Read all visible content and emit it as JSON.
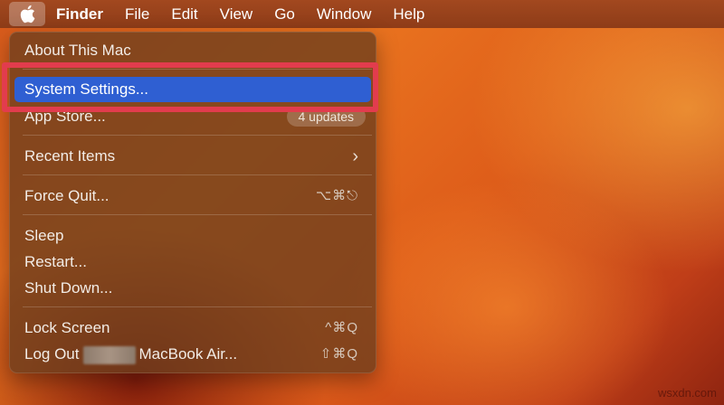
{
  "menubar": {
    "apple_icon": "apple-logo-icon",
    "app_name": "Finder",
    "items": [
      "File",
      "Edit",
      "View",
      "Go",
      "Window",
      "Help"
    ]
  },
  "apple_menu": {
    "about": "About This Mac",
    "system_settings": "System Settings...",
    "app_store": "App Store...",
    "app_store_badge": "4 updates",
    "recent_items": "Recent Items",
    "recent_items_chevron": "chevron-right-icon",
    "force_quit": "Force Quit...",
    "force_quit_shortcut": "⌥⌘⎋",
    "sleep": "Sleep",
    "restart": "Restart...",
    "shut_down": "Shut Down...",
    "lock_screen": "Lock Screen",
    "lock_screen_shortcut": "^⌘Q",
    "log_out_prefix": "Log Out",
    "log_out_suffix": "MacBook Air...",
    "log_out_shortcut": "⇧⌘Q"
  },
  "colors": {
    "highlight": "#2f5fd2",
    "annotation_frame": "#e23c4d"
  },
  "watermark": "wsxdn.com"
}
